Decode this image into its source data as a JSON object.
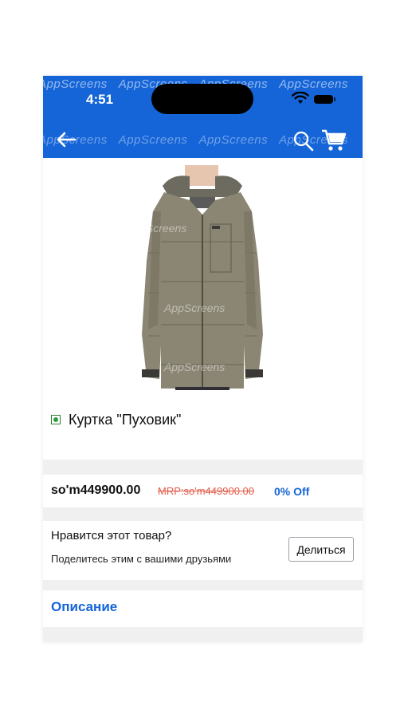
{
  "status_bar": {
    "time": "4:51"
  },
  "watermark": {
    "text": "AppScreens"
  },
  "header": {
    "back_icon": "back-arrow-icon",
    "search_icon": "search-icon",
    "cart_icon": "cart-icon",
    "bar_color": "#1565d8"
  },
  "product": {
    "image": "olive-puffer-jacket",
    "title": "Куртка \"Пуховик\"",
    "veg_mark_color": "#2e9e3a"
  },
  "pricing": {
    "price": "so'm449900.00",
    "mrp": "MRP:so'm449900.00",
    "discount": "0% Off",
    "mrp_color": "#e15d4a",
    "accent": "#1565d8"
  },
  "share": {
    "title": "Нравится этот товар?",
    "subtitle": "Поделитесь этим с вашими друзьями",
    "button_label": "Делиться"
  },
  "description": {
    "title": "Описание"
  }
}
